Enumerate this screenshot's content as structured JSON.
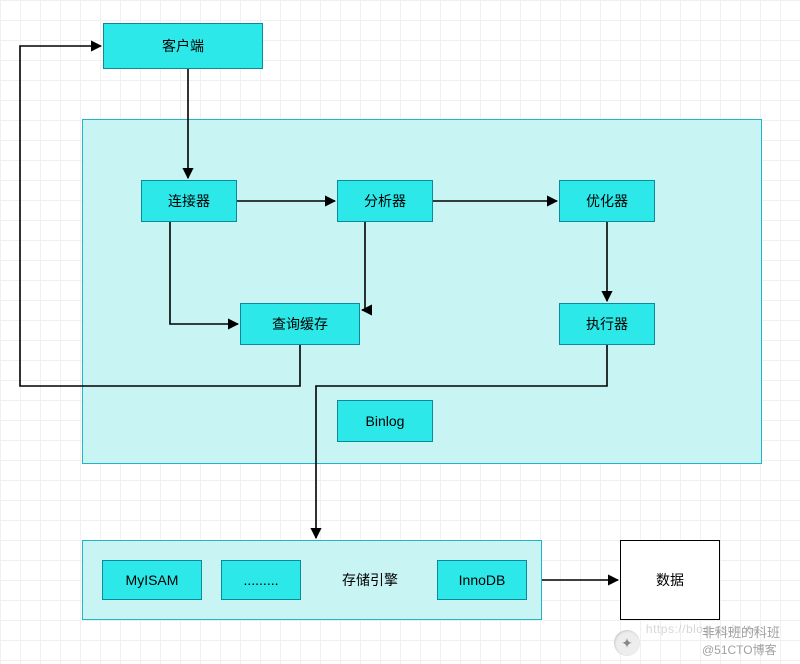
{
  "client": "客户端",
  "server_box": {
    "connector": "连接器",
    "parser": "分析器",
    "optimizer": "优化器",
    "cache": "查询缓存",
    "executor": "执行器",
    "binlog": "Binlog"
  },
  "storage": {
    "label": "存储引擎",
    "engine_left": "MyISAM",
    "engine_dots": ".........",
    "engine_right": "InnoDB"
  },
  "data_node": "数据",
  "watermark_line1": "https://blog.csdn.ne",
  "watermark_line2": "@51CTO博客",
  "brand": "非科班的科班",
  "chart_data": {
    "type": "diagram",
    "nodes": [
      {
        "id": "client",
        "label": "客户端"
      },
      {
        "id": "connector",
        "label": "连接器"
      },
      {
        "id": "parser",
        "label": "分析器"
      },
      {
        "id": "optimizer",
        "label": "优化器"
      },
      {
        "id": "cache",
        "label": "查询缓存"
      },
      {
        "id": "executor",
        "label": "执行器"
      },
      {
        "id": "binlog",
        "label": "Binlog"
      },
      {
        "id": "storage",
        "label": "存储引擎",
        "children": [
          "MyISAM",
          ".........",
          "InnoDB"
        ]
      },
      {
        "id": "data",
        "label": "数据"
      }
    ],
    "edges": [
      {
        "from": "client",
        "to": "connector"
      },
      {
        "from": "connector",
        "to": "parser"
      },
      {
        "from": "parser",
        "to": "optimizer"
      },
      {
        "from": "optimizer",
        "to": "executor"
      },
      {
        "from": "connector",
        "to": "cache"
      },
      {
        "from": "parser",
        "to": "cache"
      },
      {
        "from": "cache",
        "to": "client"
      },
      {
        "from": "executor",
        "to": "storage",
        "via": "cache-bottom"
      },
      {
        "from": "storage",
        "to": "data"
      }
    ]
  }
}
